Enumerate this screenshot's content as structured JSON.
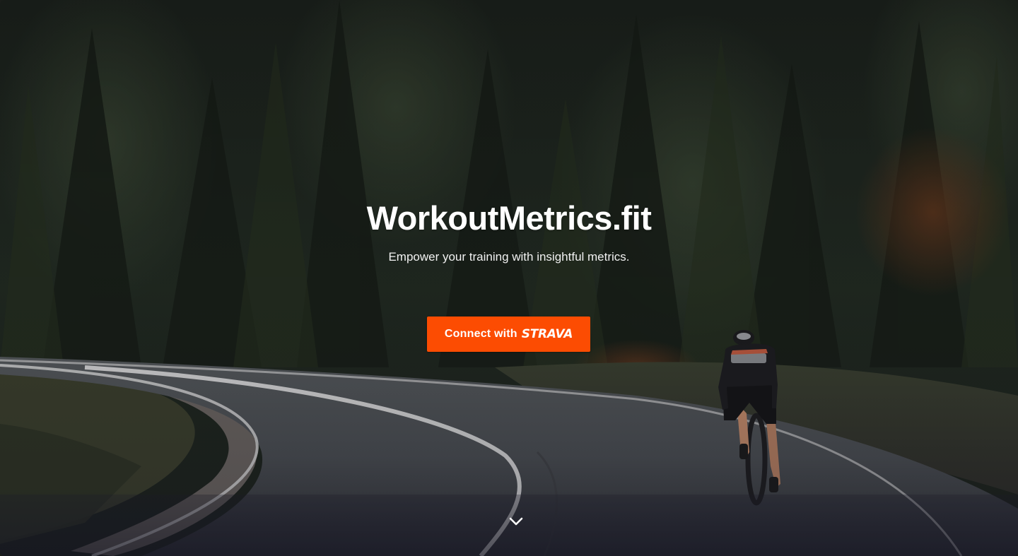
{
  "hero": {
    "title": "WorkoutMetrics.fit",
    "subtitle": "Empower your training with insightful metrics.",
    "cta": {
      "prefix": "Connect with",
      "brand": "STRAVA",
      "color": "#fc4c02"
    },
    "scroll_icon": "chevron-down-icon",
    "background_image": "cyclist riding on curving asphalt road through dark pine forest"
  }
}
